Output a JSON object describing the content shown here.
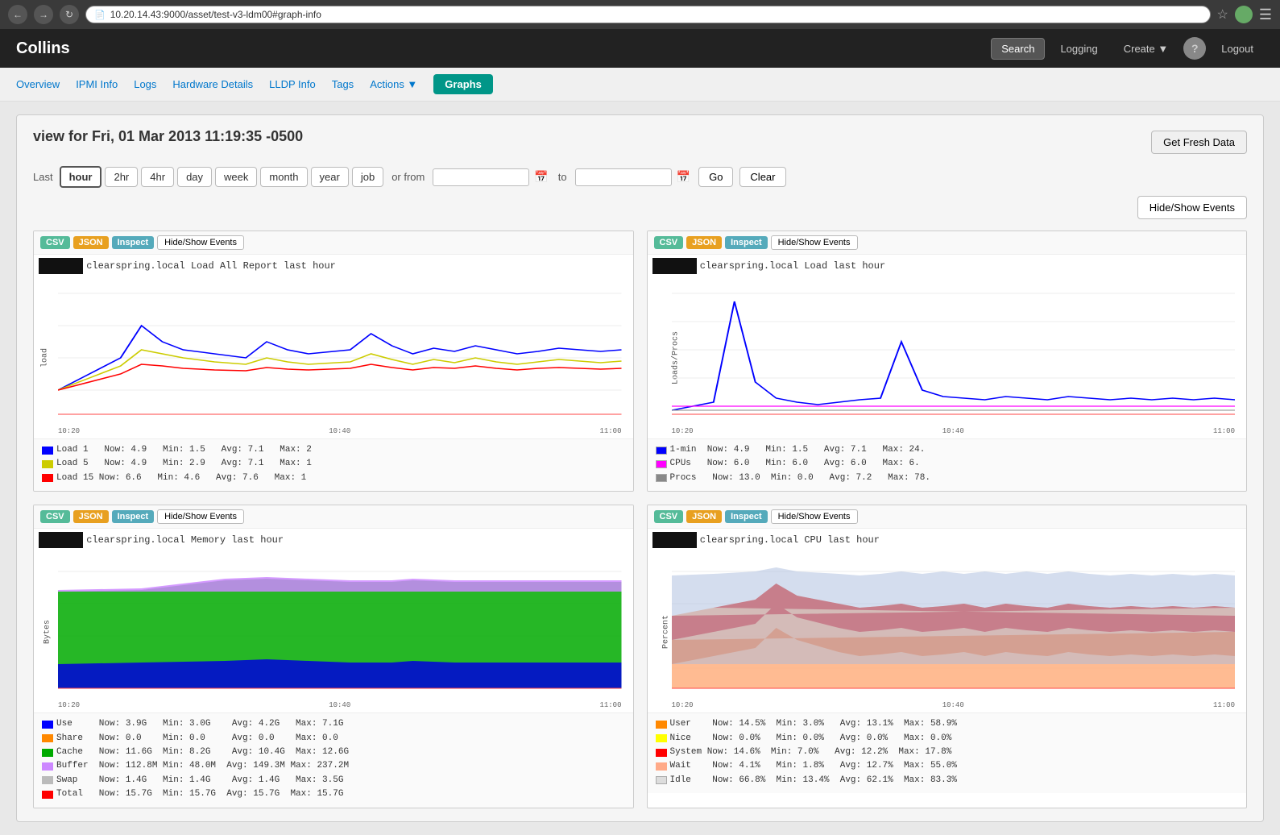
{
  "browser": {
    "url": "10.20.14.43:9000/asset/test-v3-ldm00#graph-info",
    "back_title": "back",
    "forward_title": "forward",
    "refresh_title": "refresh"
  },
  "app": {
    "title": "Collins",
    "nav": {
      "search_label": "Search",
      "logging_label": "Logging",
      "create_label": "Create",
      "info_label": "?",
      "logout_label": "Logout"
    }
  },
  "sub_nav": {
    "items": [
      {
        "label": "Overview",
        "active": false
      },
      {
        "label": "IPMI Info",
        "active": false
      },
      {
        "label": "Logs",
        "active": false
      },
      {
        "label": "Hardware Details",
        "active": false
      },
      {
        "label": "LLDP Info",
        "active": false
      },
      {
        "label": "Tags",
        "active": false
      },
      {
        "label": "Actions",
        "active": false,
        "dropdown": true
      },
      {
        "label": "Graphs",
        "active": true
      }
    ]
  },
  "page": {
    "title": "view for Fri, 01 Mar 2013 11:19:35 -0500",
    "get_fresh_btn": "Get Fresh Data",
    "hide_show_events_btn": "Hide/Show Events",
    "time_controls": {
      "last_label": "Last",
      "buttons": [
        "hour",
        "2hr",
        "4hr",
        "day",
        "week",
        "month",
        "year",
        "job"
      ],
      "active": "hour",
      "or_from_label": "or from",
      "to_label": "to",
      "go_label": "Go",
      "clear_label": "Clear",
      "from_placeholder": "",
      "to_placeholder": ""
    }
  },
  "graphs": [
    {
      "id": "load-all",
      "title_bar": "clearspring.local Load All Report last hour",
      "toolbar": {
        "csv": "CSV",
        "json": "JSON",
        "inspect": "Inspect",
        "hide_show": "Hide/Show Events"
      },
      "y_label": "load",
      "x_labels": [
        "10:20",
        "10:40",
        "11:00"
      ],
      "legend": [
        {
          "color": "#00f",
          "label": "Load 1",
          "now": "4.9",
          "min": "1.5",
          "avg": "7.1",
          "max": "2"
        },
        {
          "color": "#ff0",
          "label": "Load 5",
          "now": "4.9",
          "min": "2.9",
          "avg": "7.1",
          "max": "1"
        },
        {
          "color": "#f00",
          "label": "Load 15",
          "now": "6.6",
          "min": "4.6",
          "avg": "7.6",
          "max": "1"
        }
      ],
      "type": "line"
    },
    {
      "id": "load",
      "title_bar": "clearspring.local Load last hour",
      "toolbar": {
        "csv": "CSV",
        "json": "JSON",
        "inspect": "Inspect",
        "hide_show": "Hide/Show Events"
      },
      "y_label": "Loads/Procs",
      "x_labels": [
        "10:20",
        "10:40",
        "11:00"
      ],
      "legend": [
        {
          "color": "#00f",
          "label": "1-min",
          "now": "4.9",
          "min": "1.5",
          "avg": "7.1",
          "max": "24."
        },
        {
          "color": "#f0f",
          "label": "CPUs",
          "now": "6.0",
          "min": "6.0",
          "avg": "6.0",
          "max": "6."
        },
        {
          "color": "#88a",
          "label": "Procs",
          "now": "13.0",
          "min": "0.0",
          "avg": "7.2",
          "max": "78."
        }
      ],
      "type": "line"
    },
    {
      "id": "memory",
      "title_bar": "clearspring.local Memory last hour",
      "toolbar": {
        "csv": "CSV",
        "json": "JSON",
        "inspect": "Inspect",
        "hide_show": "Hide/Show Events"
      },
      "y_label": "Bytes",
      "x_labels": [
        "10:20",
        "10:40",
        "11:00"
      ],
      "legend": [
        {
          "color": "#00f",
          "label": "Use",
          "now": "3.9G",
          "min": "3.0G",
          "avg": "4.2G",
          "max": "7.1G"
        },
        {
          "color": "#f80",
          "label": "Share",
          "now": "0.0",
          "min": "0.0",
          "avg": "0.0",
          "max": "0.0"
        },
        {
          "color": "#0c0",
          "label": "Cache",
          "now": "11.6G",
          "min": "8.2G",
          "avg": "10.4G",
          "max": "12.6G"
        },
        {
          "color": "#c8f",
          "label": "Buffer",
          "now": "112.8M",
          "min": "48.0M",
          "avg": "149.3M",
          "max": "237.2M"
        },
        {
          "color": "#ccc",
          "label": "Swap",
          "now": "1.4G",
          "min": "1.4G",
          "avg": "1.4G",
          "max": "3.5G"
        },
        {
          "color": "#f00",
          "label": "Total",
          "now": "15.7G",
          "min": "15.7G",
          "avg": "15.7G",
          "max": "15.7G"
        }
      ],
      "type": "stacked"
    },
    {
      "id": "cpu",
      "title_bar": "clearspring.local CPU last hour",
      "toolbar": {
        "csv": "CSV",
        "json": "JSON",
        "inspect": "Inspect",
        "hide_show": "Hide/Show Events"
      },
      "y_label": "Percent",
      "x_labels": [
        "10:20",
        "10:40",
        "11:00"
      ],
      "legend": [
        {
          "color": "#f80",
          "label": "User",
          "now": "14.5%",
          "min": "3.0%",
          "avg": "13.1%",
          "max": "58.9%"
        },
        {
          "color": "#ff0",
          "label": "Nice",
          "now": "0.0%",
          "min": "0.0%",
          "avg": "0.0%",
          "max": "0.0%"
        },
        {
          "color": "#f00",
          "label": "System",
          "now": "14.6%",
          "min": "7.0%",
          "avg": "12.2%",
          "max": "17.8%"
        },
        {
          "color": "#fa8",
          "label": "Wait",
          "now": "4.1%",
          "min": "1.8%",
          "avg": "12.7%",
          "max": "55.0%"
        },
        {
          "color": "#fff",
          "label": "Idle",
          "now": "66.8%",
          "min": "13.4%",
          "avg": "62.1%",
          "max": "83.3%"
        }
      ],
      "type": "stacked_cpu"
    }
  ],
  "colors": {
    "accent": "#009688",
    "link": "#0077cc",
    "header_bg": "#222"
  }
}
